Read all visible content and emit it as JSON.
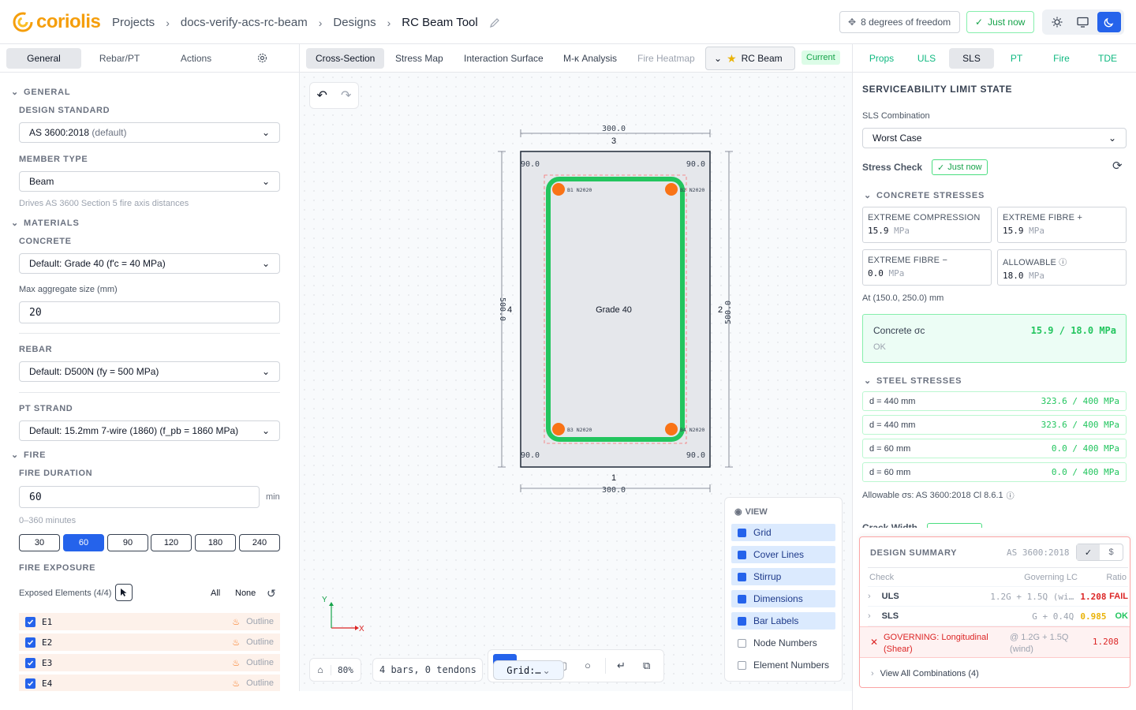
{
  "header": {
    "logo_text": "coriolis",
    "breadcrumbs": [
      "Projects",
      "docs-verify-acs-rc-beam",
      "Designs",
      "RC Beam Tool"
    ],
    "dof_label": "8 degrees of freedom",
    "saved_label": "Just now"
  },
  "left": {
    "tabs": [
      "General",
      "Rebar/PT",
      "Actions"
    ],
    "general_heading": "GENERAL",
    "design_standard_label": "DESIGN STANDARD",
    "design_standard_value": "AS 3600:2018",
    "design_standard_suffix": "(default)",
    "member_type_label": "MEMBER TYPE",
    "member_type_value": "Beam",
    "member_type_hint": "Drives AS 3600 Section 5 fire axis distances",
    "materials_heading": "MATERIALS",
    "concrete_label": "CONCRETE",
    "concrete_value": "Default: Grade 40 (f'c = 40 MPa)",
    "agg_label": "Max aggregate size (mm)",
    "agg_value": "20",
    "rebar_label": "REBAR",
    "rebar_value": "Default: D500N (fy = 500 MPa)",
    "pt_label": "PT STRAND",
    "pt_value": "Default: 15.2mm 7-wire (1860) (f_pb = 1860 MPa)",
    "fire_heading": "FIRE",
    "fire_duration_label": "FIRE DURATION",
    "fire_duration_value": "60",
    "fire_unit": "min",
    "fire_range_hint": "0–360 minutes",
    "fire_presets": [
      "30",
      "60",
      "90",
      "120",
      "180",
      "240"
    ],
    "fire_selected": "60",
    "fire_exposure_label": "FIRE EXPOSURE",
    "exposed_label": "Exposed Elements (4/4)",
    "all_label": "All",
    "none_label": "None",
    "elements": [
      {
        "name": "E1",
        "mode": "Outline"
      },
      {
        "name": "E2",
        "mode": "Outline"
      },
      {
        "name": "E3",
        "mode": "Outline"
      },
      {
        "name": "E4",
        "mode": "Outline"
      }
    ]
  },
  "center": {
    "tabs": [
      "Cross-Section",
      "Stress Map",
      "Interaction Surface",
      "M-κ Analysis",
      "Fire Heatmap"
    ],
    "design_select": "RC Beam",
    "current_badge": "Current",
    "dims": {
      "top": "300.0",
      "bottom": "300.0",
      "left": "500.0",
      "right": "500.0",
      "cover_tl": "90.0",
      "cover_tr": "90.0",
      "cover_bl": "90.0",
      "cover_br": "90.0"
    },
    "edges": {
      "top": "3",
      "right": "2",
      "bottom": "1",
      "left": "4"
    },
    "material_label": "Grade 40",
    "bars": [
      {
        "label": "B1 N2020"
      },
      {
        "label": "B2 N2020"
      },
      {
        "label": "B3 N2020"
      },
      {
        "label": "B4 N2020"
      }
    ],
    "axis_x": "X",
    "axis_y": "Y",
    "zoom": "80%",
    "count_label": "4 bars, 0 tendons",
    "grid_select": "Grid:…",
    "view": {
      "title": "VIEW",
      "items": [
        {
          "label": "Grid",
          "on": true
        },
        {
          "label": "Cover Lines",
          "on": true
        },
        {
          "label": "Stirrup",
          "on": true
        },
        {
          "label": "Dimensions",
          "on": true
        },
        {
          "label": "Bar Labels",
          "on": true
        },
        {
          "label": "Node Numbers",
          "on": false
        },
        {
          "label": "Element Numbers",
          "on": false
        }
      ]
    }
  },
  "right": {
    "tabs": [
      "Props",
      "ULS",
      "SLS",
      "PT",
      "Fire",
      "TDE"
    ],
    "active_tab": "SLS",
    "title": "SERVICEABILITY LIMIT STATE",
    "combo_label": "SLS Combination",
    "combo_value": "Worst Case",
    "stress_check_label": "Stress Check",
    "stress_check_badge": "Just now",
    "concrete_heading": "CONCRETE STRESSES",
    "cards": [
      {
        "title": "EXTREME COMPRESSION",
        "value": "15.9",
        "unit": "MPa"
      },
      {
        "title": "EXTREME FIBRE +",
        "value": "15.9",
        "unit": "MPa"
      },
      {
        "title": "EXTREME FIBRE −",
        "value": "0.0",
        "unit": "MPa"
      },
      {
        "title": "ALLOWABLE",
        "value": "18.0",
        "unit": "MPa"
      }
    ],
    "at_label": "At (150.0, 250.0) mm",
    "sigma_label": "Concrete σc",
    "sigma_value": "15.9 / 18.0 MPa",
    "sigma_status": "OK",
    "steel_heading": "STEEL STRESSES",
    "steel": [
      {
        "d": "d = 440 mm",
        "v": "323.6 / 400 MPa"
      },
      {
        "d": "d = 440 mm",
        "v": "323.6 / 400 MPa"
      },
      {
        "d": "d = 60 mm",
        "v": "0.0 / 400 MPa"
      },
      {
        "d": "d = 60 mm",
        "v": "0.0 / 400 MPa"
      }
    ],
    "allowable_note": "Allowable σs: AS 3600:2018 Cl 8.6.1",
    "crack_label": "Crack Width",
    "summary": {
      "title": "DESIGN SUMMARY",
      "standard": "AS 3600:2018",
      "cols": [
        "Check",
        "Governing LC",
        "Ratio"
      ],
      "rows": [
        {
          "check": "ULS",
          "lc": "1.2G + 1.5Q (wi…",
          "ratio": "1.208",
          "status": "FAIL"
        },
        {
          "check": "SLS",
          "lc": "G + 0.4Q",
          "ratio": "0.985",
          "status": "OK"
        }
      ],
      "governing_text": "GOVERNING: Longitudinal (Shear)",
      "governing_lc": "@ 1.2G + 1.5Q (wind)",
      "governing_ratio": "1.208",
      "view_all": "View All Combinations (4)"
    }
  },
  "colors": {
    "accent": "#2563eb",
    "ok": "#22c55e",
    "fail": "#dc2626",
    "stirrup": "#22c55e",
    "bar": "#f97316",
    "logo": "#f59e0b"
  }
}
